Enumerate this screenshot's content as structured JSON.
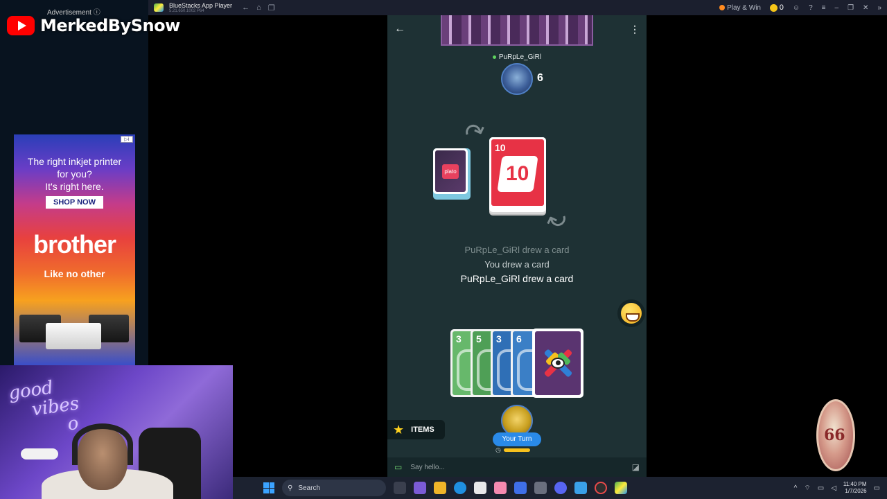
{
  "stream": {
    "channel_name": "MerkedBySnow",
    "ad_label": "Advertisement ⓘ"
  },
  "ad": {
    "headline_1": "The right inkjet printer",
    "headline_2": "for you?",
    "headline_3": "It's right here.",
    "cta": "SHOP NOW",
    "brand": "brother",
    "tagline": "Like no other"
  },
  "webcam": {
    "neon_line_1": "good",
    "neon_line_2": "vibes",
    "neon_line_3": "o"
  },
  "window": {
    "title": "BlueStacks App Player",
    "subtitle": "5.21.650.1002 P64",
    "play_win_label": "Play & Win",
    "coin_count": "0"
  },
  "game": {
    "opponent": {
      "name": "PuRpLe_GiRl",
      "card_count": "6"
    },
    "draw_pile_logo": "plato",
    "discard": {
      "small": "10",
      "big": "10",
      "color": "#e73245"
    },
    "log": [
      "PuRpLe_GiRl drew a card",
      "You drew a card",
      "PuRpLe_GiRl drew a card"
    ],
    "hand": [
      {
        "value": "3",
        "color": "#67b86b"
      },
      {
        "value": "5",
        "color": "#4f9f56"
      },
      {
        "value": "3",
        "color": "#2f6fb6"
      },
      {
        "value": "6",
        "color": "#3b7fc6"
      }
    ],
    "items_label": "ITEMS",
    "turn_label": "Your Turn",
    "timer_remaining": 0.75,
    "chat_placeholder": "Say hello..."
  },
  "chip": {
    "label": "66"
  },
  "taskbar": {
    "search_label": "Search",
    "time": "11:40 PM",
    "date": "1/7/2026"
  }
}
